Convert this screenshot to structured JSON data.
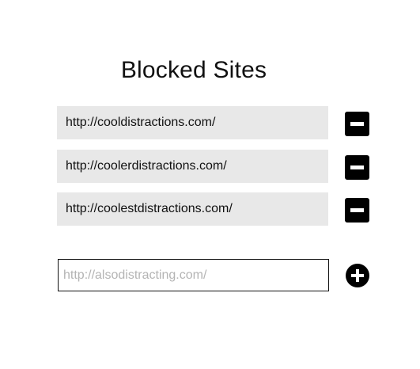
{
  "page": {
    "title": "Blocked Sites"
  },
  "blocked_sites": [
    {
      "url": "http://cooldistractions.com/",
      "remove_icon": "minus-square-icon"
    },
    {
      "url": "http://coolerdistractions.com/",
      "remove_icon": "minus-square-icon"
    },
    {
      "url": "http://coolestdistractions.com/",
      "remove_icon": "minus-square-icon"
    }
  ],
  "add_site": {
    "value": "",
    "placeholder": "http://alsodistracting.com/",
    "add_icon": "plus-circle-icon"
  },
  "colors": {
    "row_background": "#e8e8e8",
    "button": "#000000",
    "placeholder": "#b4b4b4"
  }
}
